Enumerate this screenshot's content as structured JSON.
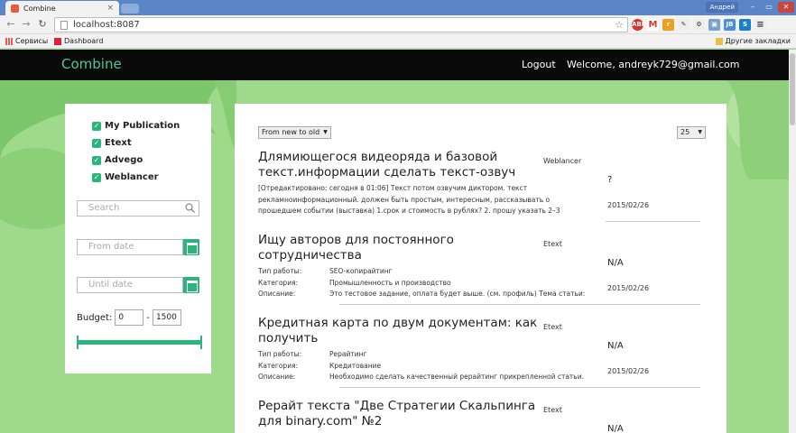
{
  "browser": {
    "tab_title": "Combine",
    "tab_close": "×",
    "user": "Андрей",
    "url": "localhost:8087",
    "bookmarks": {
      "apps": "Сервисы",
      "dashboard": "Dashboard",
      "other": "Другие закладки"
    },
    "window_controls": {
      "min": "–",
      "max": "▭",
      "close": "✕"
    }
  },
  "header": {
    "brand": "Combine",
    "logout": "Logout",
    "welcome": "Welcome, andreyk729@gmail.com"
  },
  "sidebar": {
    "filters": [
      "My Publication",
      "Etext",
      "Advego",
      "Weblancer"
    ],
    "search_placeholder": "Search",
    "from_placeholder": "From date",
    "until_placeholder": "Until date",
    "budget_label": "Budget:",
    "budget_min": "0",
    "budget_sep": "-",
    "budget_max": "1500",
    "budget_range_fraction": [
      0.0,
      1.0
    ]
  },
  "main": {
    "sort_value": "From new to old",
    "per_page_value": "25",
    "items": [
      {
        "title": "Длямиющегося видеоряда и базовой текст.информации сделать текст-озвуч",
        "source": "Weblancer",
        "price": "?",
        "date": "2015/02/26",
        "description": "[Отредактировано: сегодня в 01:06] Текст потом озвучим диктором. текст рекламноинформационный. должен быть простым, интересным, рассказывать о прошедшем событии (выставка) 1.срок и стоимость в рублях? 2. прошу указать 2–3"
      },
      {
        "title": "Ищу авторов для постоянного сотрудничества",
        "source": "Etext",
        "price": "N/A",
        "date": "2015/02/26",
        "rows": [
          {
            "k": "Тип работы:",
            "v": "SEO-копирайтинг"
          },
          {
            "k": "Категория:",
            "v": "Промышленность и производство"
          },
          {
            "k": "Описание:",
            "v": "Это тестовое задание, оплата будет выше. (см. профиль) Тема статьи:"
          }
        ]
      },
      {
        "title": "Кредитная карта по двум документам: как получить",
        "source": "Etext",
        "price": "N/A",
        "date": "2015/02/26",
        "rows": [
          {
            "k": "Тип работы:",
            "v": "Рерайтинг"
          },
          {
            "k": "Категория:",
            "v": "Кредитование"
          },
          {
            "k": "Описание:",
            "v": "Необходимо сделать качественный рерайтинг прикрепленной статьи."
          }
        ]
      },
      {
        "title": "Рерайт текста \"Две Стратегии Скальпинга для binary.com\" №2",
        "source": "Etext",
        "price": "N/A"
      }
    ]
  },
  "colors": {
    "accent": "#2bb57c",
    "brand": "#4cc79a",
    "background": "#9fd98b",
    "header": "#0a0a0a"
  }
}
